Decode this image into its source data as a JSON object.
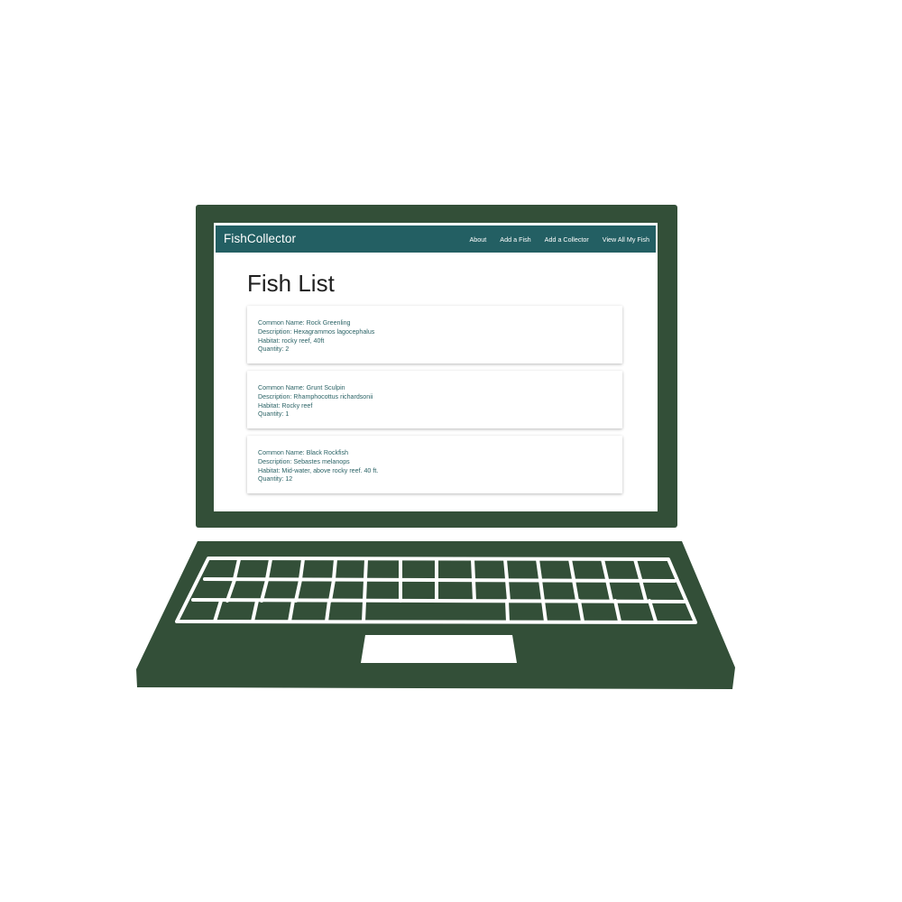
{
  "colors": {
    "laptop_body": "#334f38",
    "navbar": "#235f63",
    "card_text": "#2b6366",
    "screen_bg": "#ffffff"
  },
  "navbar": {
    "brand": "FishCollector",
    "links": [
      {
        "label": "About"
      },
      {
        "label": "Add a Fish"
      },
      {
        "label": "Add a Collector"
      },
      {
        "label": "View All My Fish"
      }
    ]
  },
  "page": {
    "title": "Fish List"
  },
  "fish": [
    {
      "common_name": "Common Name: Rock Greenling",
      "description": "Description: Hexagrammos lagocephalus",
      "habitat": "Habitat: rocky reef, 40ft",
      "quantity": "Quantity: 2"
    },
    {
      "common_name": "Common Name: Grunt Sculpin",
      "description": "Description: Rhamphocottus richardsonii",
      "habitat": "Habitat: Rocky reef",
      "quantity": "Quantity: 1"
    },
    {
      "common_name": "Common Name: Black Rockfish",
      "description": "Description: Sebastes melanops",
      "habitat": "Habitat: Mid-water, above rocky reef. 40 ft.",
      "quantity": "Quantity: 12"
    }
  ]
}
